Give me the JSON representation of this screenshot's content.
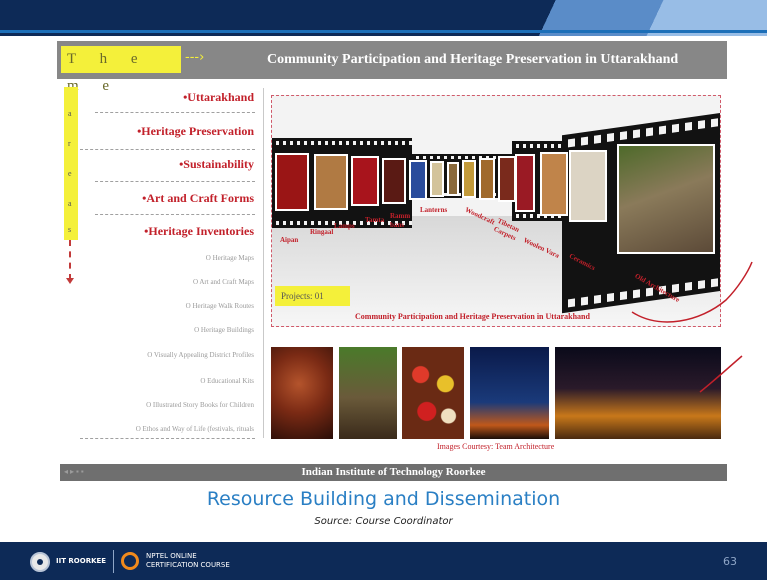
{
  "theme": {
    "label": "T h e m e",
    "arrow": "---›",
    "title": "Community Participation and Heritage Preservation in Uttarakhand"
  },
  "areas_label": [
    "a",
    "r",
    "e",
    "a",
    "s"
  ],
  "main_items": [
    "•Uttarakhand",
    "•Heritage Preservation",
    "•Sustainability",
    "•Art and Craft Forms",
    "•Heritage Inventories"
  ],
  "sub_items": [
    "O Heritage Maps",
    "O Art and Craft Maps",
    "O Heritage Walk Routes",
    "O Heritage Buildings",
    "O Visually Appealing District Profiles",
    "O Educational Kits",
    "O Illustrated Story Books for Children",
    "O Ethos and Way of Life (festivals, rituals"
  ],
  "film_captions": [
    "Aipan",
    "Ringaal",
    "Lamps",
    "Tamta",
    "Ramm bans",
    "Lanterns",
    "Woodcraft",
    "Tibetan Carpets",
    "Woolen Vara",
    "Ceramics",
    "Old Architecture"
  ],
  "projects_label": "Projects: 01",
  "panel_caption": "Community Participation and Heritage Preservation in Uttarakhand",
  "image_credit": "Images Courtesy: Team Architecture",
  "footer_bar": "Indian Institute of Technology Roorkee",
  "slide_title": "Resource Building and Dissemination",
  "slide_source": "Source: Course Coordinator",
  "brand": {
    "iitr": "IIT ROORKEE",
    "nptel_line1": "NPTEL ONLINE",
    "nptel_line2": "CERTIFICATION COURSE"
  },
  "page_number": "63",
  "colors": {
    "navy": "#0d2a57",
    "accent_red": "#c2202a",
    "highlight_yellow": "#f4f03a",
    "title_blue": "#2a7fc4",
    "gray_bar": "#878787"
  }
}
